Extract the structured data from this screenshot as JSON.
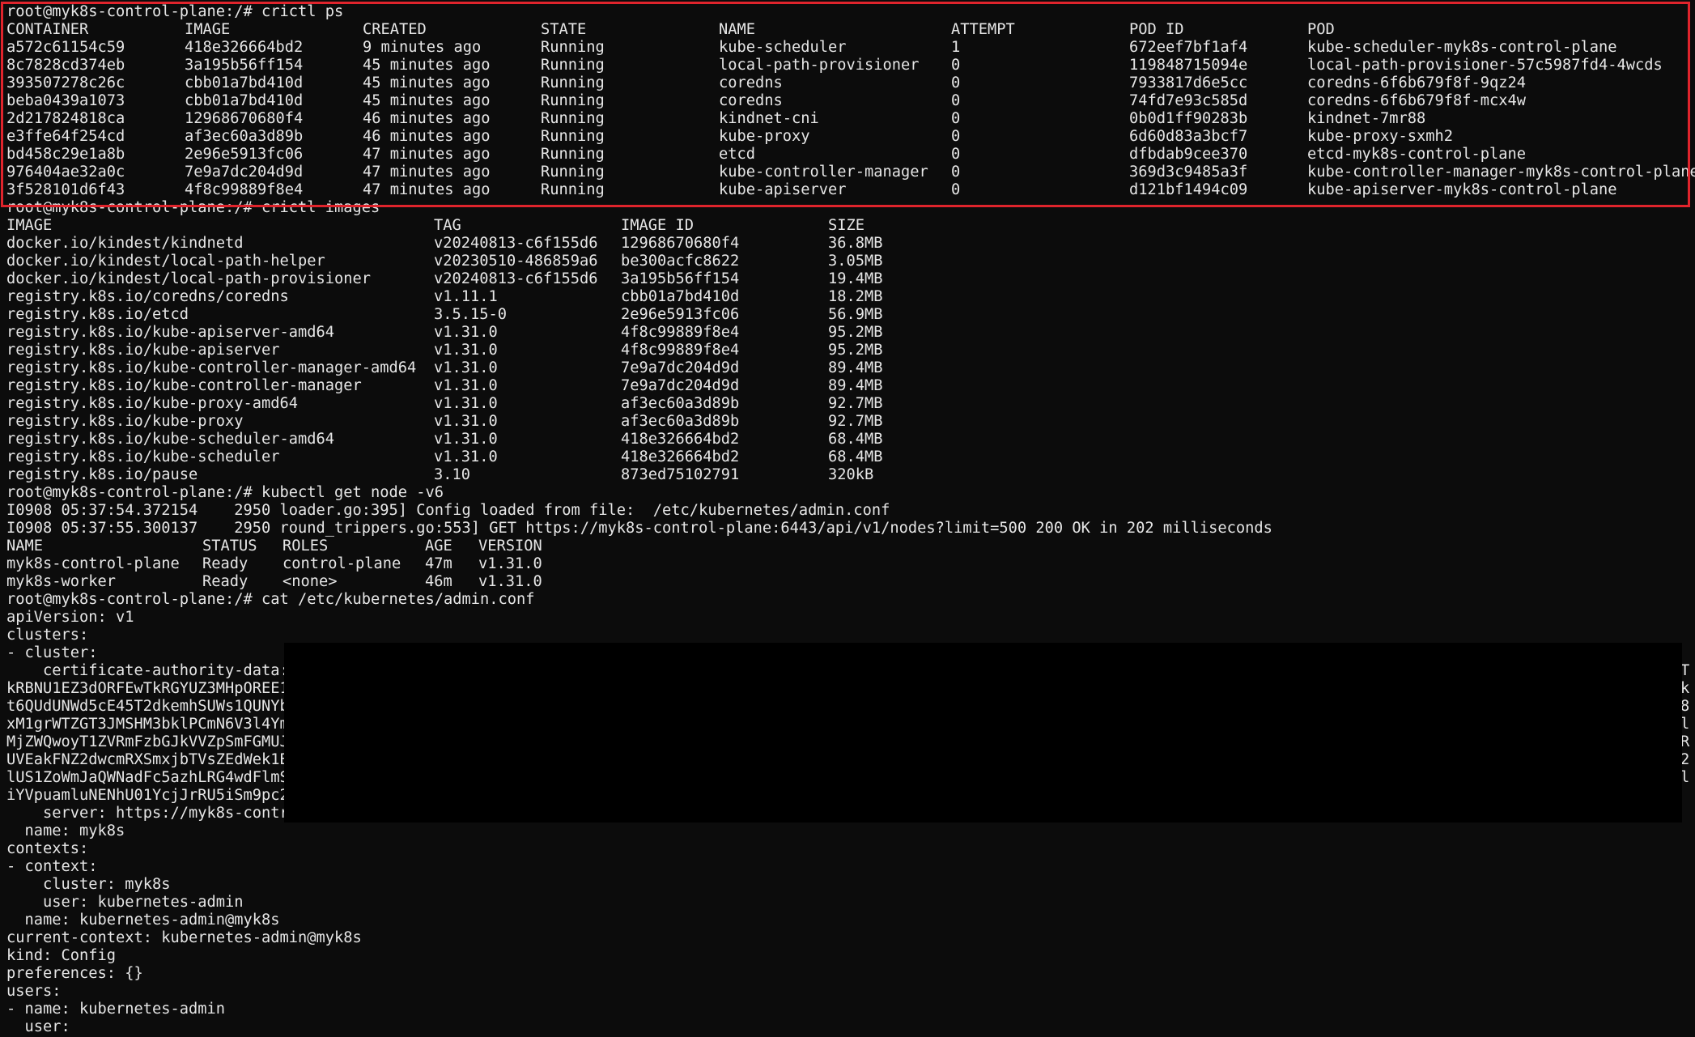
{
  "cmd_crictl_ps": {
    "prompt": "root@myk8s-control-plane:/# crictl ps",
    "headers": [
      "CONTAINER",
      "IMAGE",
      "CREATED",
      "STATE",
      "NAME",
      "ATTEMPT",
      "POD ID",
      "POD"
    ],
    "rows": [
      [
        "a572c61154c59",
        "418e326664bd2",
        "9 minutes ago",
        "Running",
        "kube-scheduler",
        "1",
        "672eef7bf1af4",
        "kube-scheduler-myk8s-control-plane"
      ],
      [
        "8c7828cd374eb",
        "3a195b56ff154",
        "45 minutes ago",
        "Running",
        "local-path-provisioner",
        "0",
        "119848715094e",
        "local-path-provisioner-57c5987fd4-4wcds"
      ],
      [
        "393507278c26c",
        "cbb01a7bd410d",
        "45 minutes ago",
        "Running",
        "coredns",
        "0",
        "7933817d6e5cc",
        "coredns-6f6b679f8f-9qz24"
      ],
      [
        "beba0439a1073",
        "cbb01a7bd410d",
        "45 minutes ago",
        "Running",
        "coredns",
        "0",
        "74fd7e93c585d",
        "coredns-6f6b679f8f-mcx4w"
      ],
      [
        "2d217824818ca",
        "12968670680f4",
        "46 minutes ago",
        "Running",
        "kindnet-cni",
        "0",
        "0b0d1ff90283b",
        "kindnet-7mr88"
      ],
      [
        "e3ffe64f254cd",
        "af3ec60a3d89b",
        "46 minutes ago",
        "Running",
        "kube-proxy",
        "0",
        "6d60d83a3bcf7",
        "kube-proxy-sxmh2"
      ],
      [
        "bd458c29e1a8b",
        "2e96e5913fc06",
        "47 minutes ago",
        "Running",
        "etcd",
        "0",
        "dfbdab9cee370",
        "etcd-myk8s-control-plane"
      ],
      [
        "976404ae32a0c",
        "7e9a7dc204d9d",
        "47 minutes ago",
        "Running",
        "kube-controller-manager",
        "0",
        "369d3c9485a3f",
        "kube-controller-manager-myk8s-control-plane"
      ],
      [
        "3f528101d6f43",
        "4f8c99889f8e4",
        "47 minutes ago",
        "Running",
        "kube-apiserver",
        "0",
        "d121bf1494c09",
        "kube-apiserver-myk8s-control-plane"
      ]
    ]
  },
  "cmd_crictl_images": {
    "prompt": "root@myk8s-control-plane:/# crictl images",
    "headers": [
      "IMAGE",
      "TAG",
      "IMAGE ID",
      "SIZE"
    ],
    "rows": [
      [
        "docker.io/kindest/kindnetd",
        "v20240813-c6f155d6",
        "12968670680f4",
        "36.8MB"
      ],
      [
        "docker.io/kindest/local-path-helper",
        "v20230510-486859a6",
        "be300acfc8622",
        "3.05MB"
      ],
      [
        "docker.io/kindest/local-path-provisioner",
        "v20240813-c6f155d6",
        "3a195b56ff154",
        "19.4MB"
      ],
      [
        "registry.k8s.io/coredns/coredns",
        "v1.11.1",
        "cbb01a7bd410d",
        "18.2MB"
      ],
      [
        "registry.k8s.io/etcd",
        "3.5.15-0",
        "2e96e5913fc06",
        "56.9MB"
      ],
      [
        "registry.k8s.io/kube-apiserver-amd64",
        "v1.31.0",
        "4f8c99889f8e4",
        "95.2MB"
      ],
      [
        "registry.k8s.io/kube-apiserver",
        "v1.31.0",
        "4f8c99889f8e4",
        "95.2MB"
      ],
      [
        "registry.k8s.io/kube-controller-manager-amd64",
        "v1.31.0",
        "7e9a7dc204d9d",
        "89.4MB"
      ],
      [
        "registry.k8s.io/kube-controller-manager",
        "v1.31.0",
        "7e9a7dc204d9d",
        "89.4MB"
      ],
      [
        "registry.k8s.io/kube-proxy-amd64",
        "v1.31.0",
        "af3ec60a3d89b",
        "92.7MB"
      ],
      [
        "registry.k8s.io/kube-proxy",
        "v1.31.0",
        "af3ec60a3d89b",
        "92.7MB"
      ],
      [
        "registry.k8s.io/kube-scheduler-amd64",
        "v1.31.0",
        "418e326664bd2",
        "68.4MB"
      ],
      [
        "registry.k8s.io/kube-scheduler",
        "v1.31.0",
        "418e326664bd2",
        "68.4MB"
      ],
      [
        "registry.k8s.io/pause",
        "3.10",
        "873ed75102791",
        "320kB"
      ]
    ]
  },
  "cmd_kubectl_get_node": {
    "prompt": "root@myk8s-control-plane:/# kubectl get node -v6",
    "log_lines": [
      "I0908 05:37:54.372154    2950 loader.go:395] Config loaded from file:  /etc/kubernetes/admin.conf",
      "I0908 05:37:55.300137    2950 round_trippers.go:553] GET https://myk8s-control-plane:6443/api/v1/nodes?limit=500 200 OK in 202 milliseconds"
    ],
    "headers": [
      "NAME",
      "STATUS",
      "ROLES",
      "AGE",
      "VERSION"
    ],
    "rows": [
      [
        "myk8s-control-plane",
        "Ready",
        "control-plane",
        "47m",
        "v1.31.0"
      ],
      [
        "myk8s-worker",
        "Ready",
        "<none>",
        "46m",
        "v1.31.0"
      ]
    ]
  },
  "cmd_cat_admin_conf": {
    "prompt": "root@myk8s-control-plane:/# cat /etc/kubernetes/admin.conf",
    "lines": [
      "apiVersion: v1",
      "clusters:",
      "- cluster:",
      "    certificate-authority-data:",
      "kRBNU1EZ3dORFEwTkRGYUZ3MHpOREE1",
      "t6QUdUNWd5cE45T2dkemhSUWs1QUNYb",
      "xM1grWTZGT3JMSHM3bklPCmN6V3l4Ym",
      "MjZWQwoyT1ZVRmFzbGJkVVZpSmFGMUJ",
      "UVEakFNZ2dwcmRXSmxjbTVsZEdWek1B",
      "lUS1ZoWmJaQWNadFc5azhLRG4wdFlmS",
      "iYVpuamluNENhU01YcjJrRU5iSm9pc2",
      "    server: https://myk8s-contr",
      "  name: myk8s",
      "contexts:",
      "- context:",
      "    cluster: myk8s",
      "    user: kubernetes-admin",
      "  name: kubernetes-admin@myk8s",
      "current-context: kubernetes-admin@myk8s",
      "kind: Config",
      "preferences: {}",
      "users:",
      "- name: kubernetes-admin",
      "  user:"
    ],
    "right_edge_chars": [
      "T",
      "k",
      "8",
      "l",
      "R",
      "2",
      "l"
    ]
  }
}
